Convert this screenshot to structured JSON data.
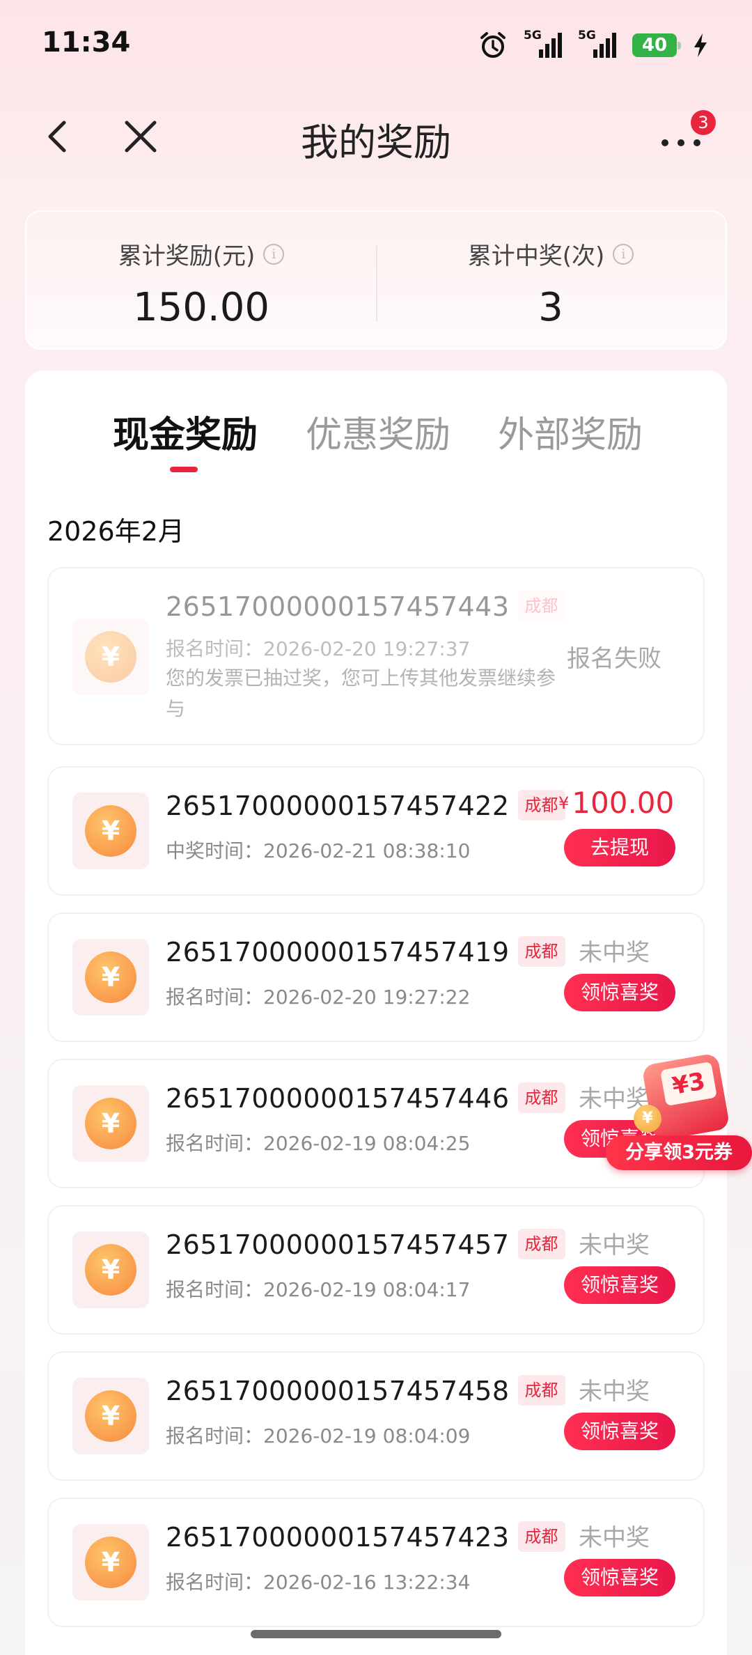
{
  "status_bar": {
    "time": "11:34",
    "signal_tag_1": "5G",
    "signal_tag_2": "5G",
    "battery": "40"
  },
  "nav": {
    "title": "我的奖励",
    "more_badge": "3"
  },
  "summary": {
    "total_reward_label": "累计奖励(元)",
    "total_reward_value": "150.00",
    "total_wins_label": "累计中奖(次)",
    "total_wins_value": "3"
  },
  "tabs": [
    "现金奖励",
    "优惠奖励",
    "外部奖励"
  ],
  "month": "2026年2月",
  "coin_symbol": "¥",
  "items": [
    {
      "id": "26517000000157457443",
      "city": "成都",
      "time": "报名时间：2026-02-20 19:27:37",
      "note": "您的发票已抽过奖，您可上传其他发票继续参与",
      "status": "报名失败"
    },
    {
      "id": "26517000000157457422",
      "city": "成都",
      "time": "中奖时间：2026-02-21 08:38:10",
      "currency": "¥",
      "amount": "100.00",
      "action": "去提现"
    },
    {
      "id": "26517000000157457419",
      "city": "成都",
      "time": "报名时间：2026-02-20 19:27:22",
      "status": "未中奖",
      "action": "领惊喜奖"
    },
    {
      "id": "26517000000157457446",
      "city": "成都",
      "time": "报名时间：2026-02-19 08:04:25",
      "status": "未中奖",
      "action": "领惊喜奖"
    },
    {
      "id": "26517000000157457457",
      "city": "成都",
      "time": "报名时间：2026-02-19 08:04:17",
      "status": "未中奖",
      "action": "领惊喜奖"
    },
    {
      "id": "26517000000157457458",
      "city": "成都",
      "time": "报名时间：2026-02-19 08:04:09",
      "status": "未中奖",
      "action": "领惊喜奖"
    },
    {
      "id": "26517000000157457423",
      "city": "成都",
      "time": "报名时间：2026-02-16 13:22:34",
      "status": "未中奖",
      "action": "领惊喜奖"
    }
  ],
  "share_promo": {
    "coupon": "¥3",
    "label": "分享领3元券"
  },
  "colors": {
    "accent": "#e8253d",
    "page_bg": "#fdeef0"
  }
}
